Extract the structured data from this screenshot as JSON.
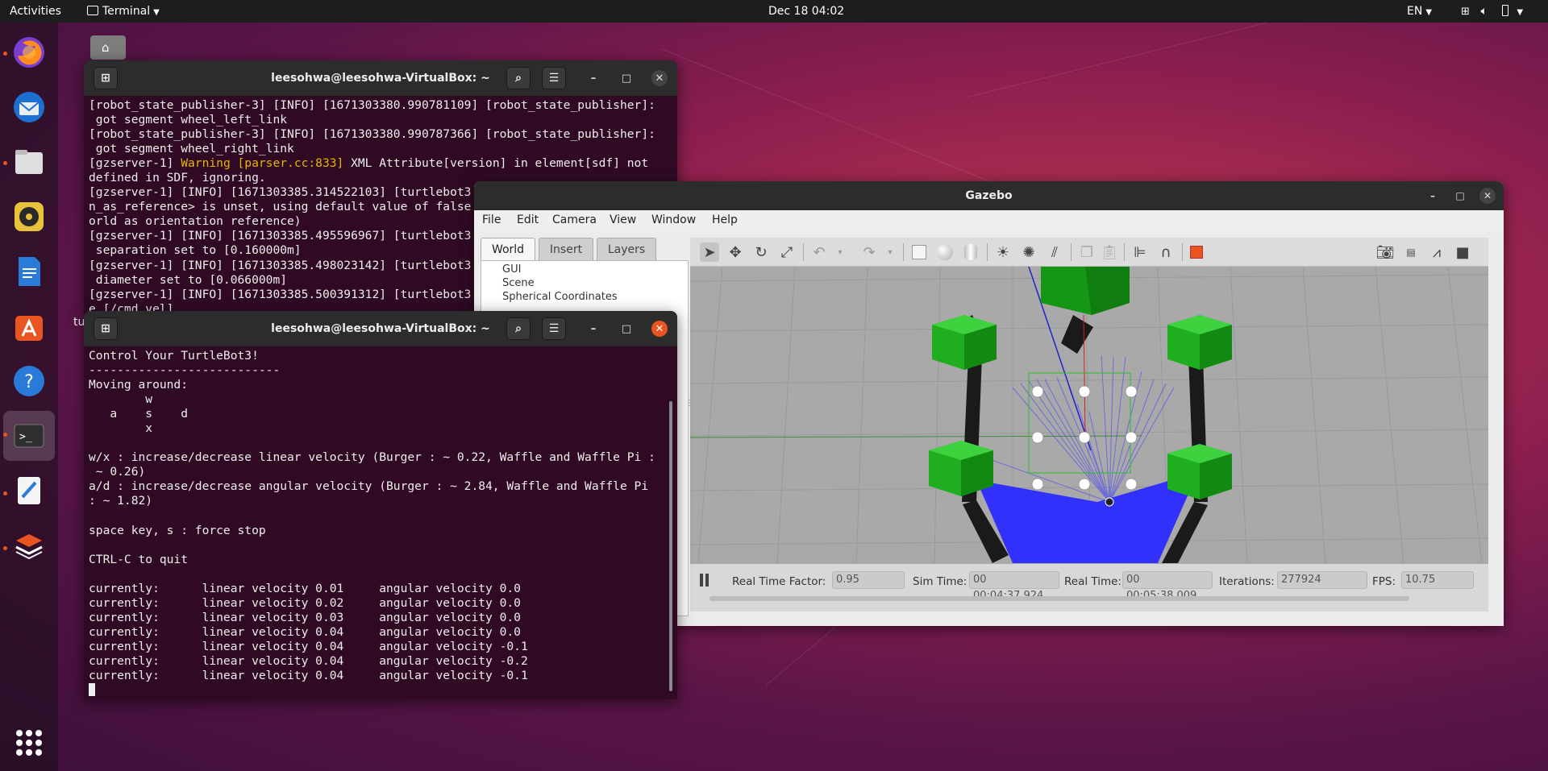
{
  "topbar": {
    "activities": "Activities",
    "app_menu": "Terminal",
    "clock": "Dec 18  04:02",
    "lang": "EN"
  },
  "desktop": {
    "stray_label": "tu"
  },
  "dock": {
    "apps": [
      "firefox-icon",
      "thunderbird-icon",
      "files-icon",
      "rhythmbox-icon",
      "libreoffice-writer-icon",
      "software-center-icon",
      "help-icon",
      "terminal-icon",
      "text-editor-icon",
      "install-icon"
    ],
    "grid": "show-applications-icon"
  },
  "term_back": {
    "title": "leesohwa@leesohwa-VirtualBox: ~",
    "lines": [
      "[robot_state_publisher-3] [INFO] [1671303380.990781109] [robot_state_publisher]:",
      " got segment wheel_left_link",
      "[robot_state_publisher-3] [INFO] [1671303380.990787366] [robot_state_publisher]:",
      " got segment wheel_right_link",
      "[gzserver-1] ",
      "defined in SDF, ignoring.",
      "[gzserver-1] [INFO] [1671303385.314522103] [turtlebot3",
      "n_as_reference> is unset, using default value of false",
      "orld as orientation reference)",
      "[gzserver-1] [INFO] [1671303385.495596967] [turtlebot3",
      " separation set to [0.160000m]",
      "[gzserver-1] [INFO] [1671303385.498023142] [turtlebot3",
      " diameter set to [0.066000m]",
      "[gzserver-1] [INFO] [1671303385.500391312] [turtlebot3",
      "e [/cmd_vel]"
    ],
    "warn_text": "Warning [parser.cc:833]",
    "warn_rest": " XML Attribute[version] in element[sdf] not"
  },
  "term_front": {
    "title": "leesohwa@leesohwa-VirtualBox: ~",
    "text": "Control Your TurtleBot3!\n---------------------------\nMoving around:\n        w\n   a    s    d\n        x\n\nw/x : increase/decrease linear velocity (Burger : ~ 0.22, Waffle and Waffle Pi :\n ~ 0.26)\na/d : increase/decrease angular velocity (Burger : ~ 2.84, Waffle and Waffle Pi\n: ~ 1.82)\n\nspace key, s : force stop\n\nCTRL-C to quit\n\ncurrently:      linear velocity 0.01     angular velocity 0.0\ncurrently:      linear velocity 0.02     angular velocity 0.0\ncurrently:      linear velocity 0.03     angular velocity 0.0\ncurrently:      linear velocity 0.04     angular velocity 0.0\ncurrently:      linear velocity 0.04     angular velocity -0.1\ncurrently:      linear velocity 0.04     angular velocity -0.2\ncurrently:      linear velocity 0.04     angular velocity -0.1"
  },
  "gazebo": {
    "title": "Gazebo",
    "menu": {
      "file": "File",
      "edit": "Edit",
      "camera": "Camera",
      "view": "View",
      "window": "Window",
      "help": "Help"
    },
    "tabs": {
      "world": "World",
      "insert": "Insert",
      "layers": "Layers"
    },
    "tree": {
      "gui": "GUI",
      "scene": "Scene",
      "spherical": "Spherical Coordinates"
    },
    "status": {
      "rtf_label": "Real Time Factor:",
      "rtf": "0.95",
      "sim_label": "Sim Time:",
      "sim": "00 00:04:37.924",
      "real_label": "Real Time:",
      "real": "00 00:05:38.009",
      "iter_label": "Iterations:",
      "iter": "277924",
      "fps_label": "FPS:",
      "fps": "10.75"
    }
  },
  "colors": {
    "ubuntu_orange": "#e95420",
    "terminal_bg": "#300a24",
    "warning": "#e8b600",
    "lidar": "#2a2aff",
    "obstacle_green": "#1fae1f"
  }
}
